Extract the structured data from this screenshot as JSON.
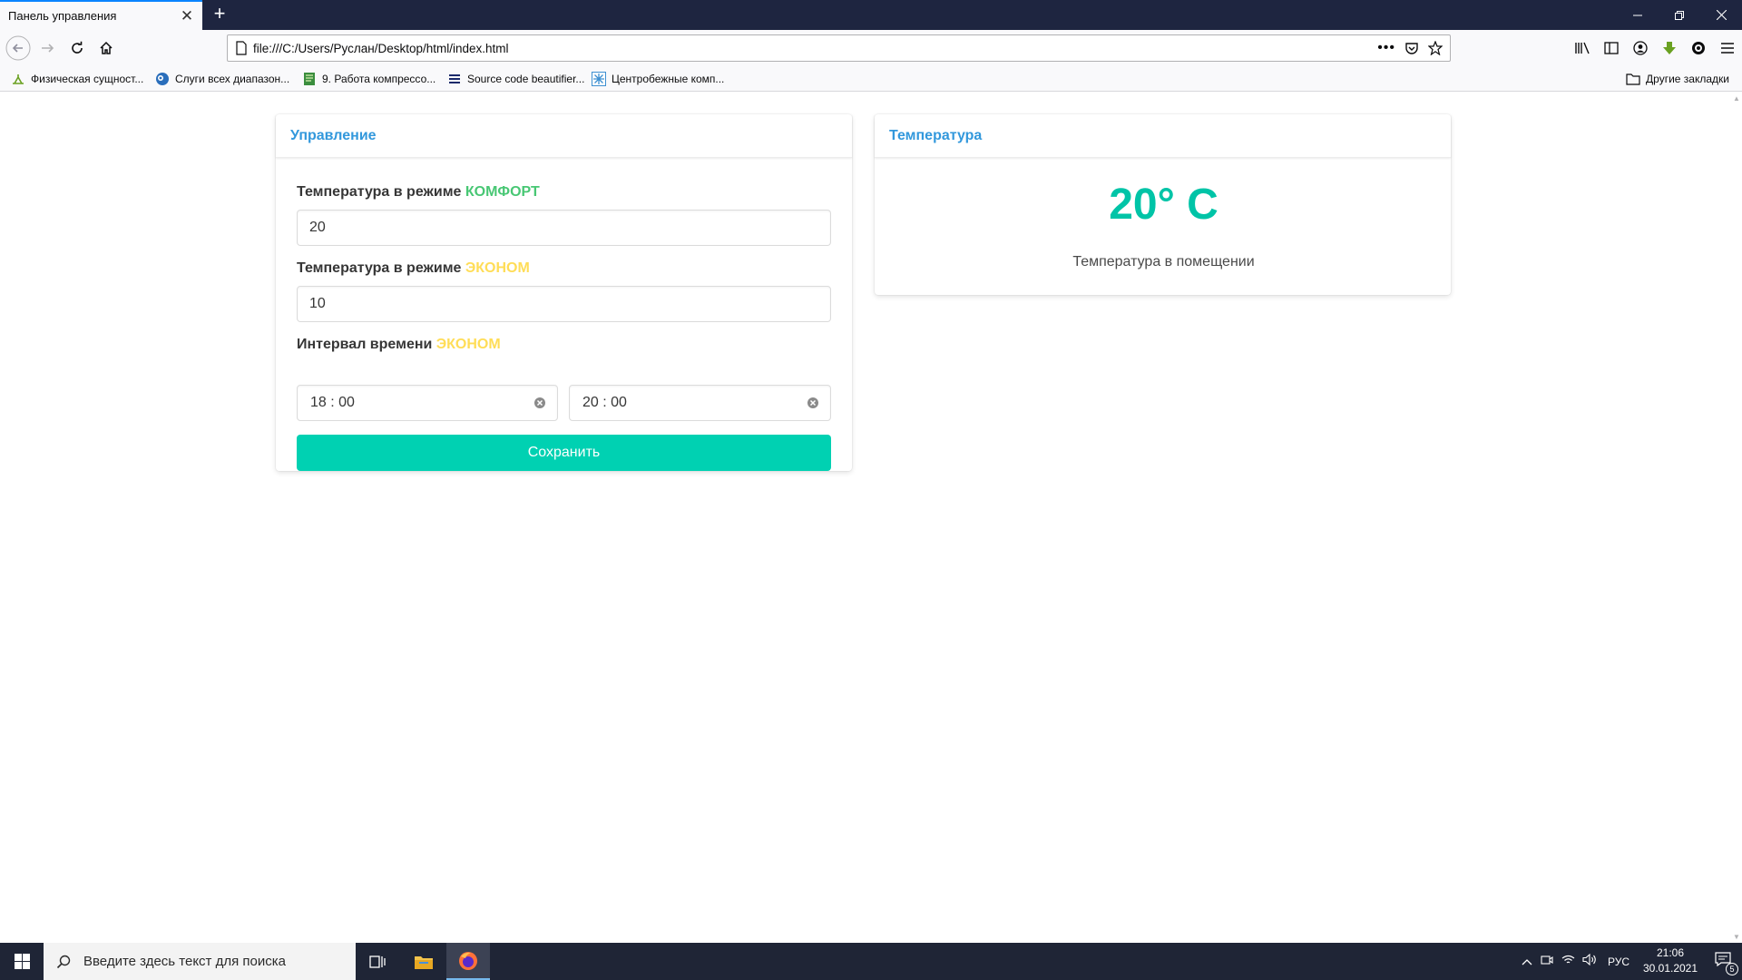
{
  "browser": {
    "tab_title": "Панель управления",
    "url": "file:///C:/Users/Руслан/Desktop/html/index.html",
    "bookmarks": [
      {
        "label": "Физическая сущност...",
        "icon": "green-leaf-icon"
      },
      {
        "label": "Слуги всех диапазон...",
        "icon": "gear-globe-icon"
      },
      {
        "label": "9. Работа компрессо...",
        "icon": "green-doc-icon"
      },
      {
        "label": "Source code beautifier...",
        "icon": "list-icon"
      },
      {
        "label": "Центробежные комп...",
        "icon": "snowflake-icon"
      }
    ],
    "other_bookmarks": "Другие закладки"
  },
  "control_panel": {
    "title": "Управление",
    "comfort_label": "Температура в режиме ",
    "comfort_mode": "КОМФОРТ",
    "comfort_value": "20",
    "econom_label": "Температура в режиме ",
    "econom_mode": "ЭКОНОМ",
    "econom_value": "10",
    "interval_label": "Интервал времени ",
    "interval_mode": "ЭКОНОМ",
    "time_from": "18 : 00",
    "time_to": "20 : 00",
    "save_label": "Сохранить"
  },
  "temperature_panel": {
    "title": "Температура",
    "value": "20° C",
    "caption": "Температура в помещении"
  },
  "taskbar": {
    "search_placeholder": "Введите здесь текст для поиска",
    "language": "РУС",
    "time": "21:06",
    "date": "30.01.2021",
    "notifications_count": "5"
  },
  "colors": {
    "accent_link": "#3298dc",
    "primary": "#00d1b2",
    "comfort": "#48c774",
    "econom": "#ffdd57"
  }
}
